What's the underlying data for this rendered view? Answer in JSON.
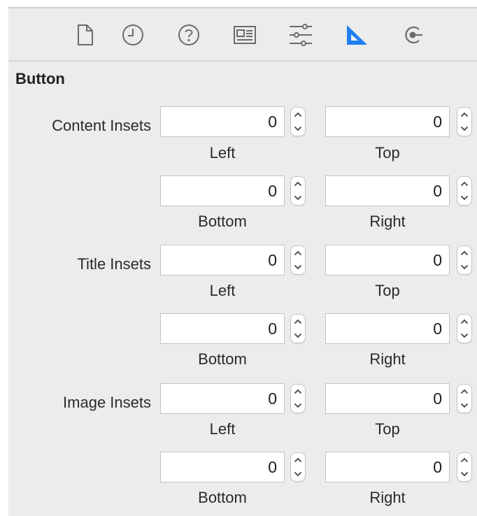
{
  "toolbar": {
    "tabs": [
      {
        "icon": "file-icon"
      },
      {
        "icon": "history-clock-icon"
      },
      {
        "icon": "help-icon"
      },
      {
        "icon": "identity-inspector-icon"
      },
      {
        "icon": "attributes-sliders-icon"
      },
      {
        "icon": "size-ruler-icon",
        "active": true
      },
      {
        "icon": "connections-icon"
      }
    ],
    "active_color": "#1f7ef1",
    "icon_color": "#6b6b6b"
  },
  "section": {
    "title": "Button"
  },
  "groups": [
    {
      "label": "Content Insets",
      "fields": {
        "left": {
          "value": "0",
          "label": "Left"
        },
        "top": {
          "value": "0",
          "label": "Top"
        },
        "bottom": {
          "value": "0",
          "label": "Bottom"
        },
        "right": {
          "value": "0",
          "label": "Right"
        }
      }
    },
    {
      "label": "Title Insets",
      "fields": {
        "left": {
          "value": "0",
          "label": "Left"
        },
        "top": {
          "value": "0",
          "label": "Top"
        },
        "bottom": {
          "value": "0",
          "label": "Bottom"
        },
        "right": {
          "value": "0",
          "label": "Right"
        }
      }
    },
    {
      "label": "Image Insets",
      "fields": {
        "left": {
          "value": "0",
          "label": "Left"
        },
        "top": {
          "value": "0",
          "label": "Top"
        },
        "bottom": {
          "value": "0",
          "label": "Bottom"
        },
        "right": {
          "value": "0",
          "label": "Right"
        }
      }
    }
  ]
}
